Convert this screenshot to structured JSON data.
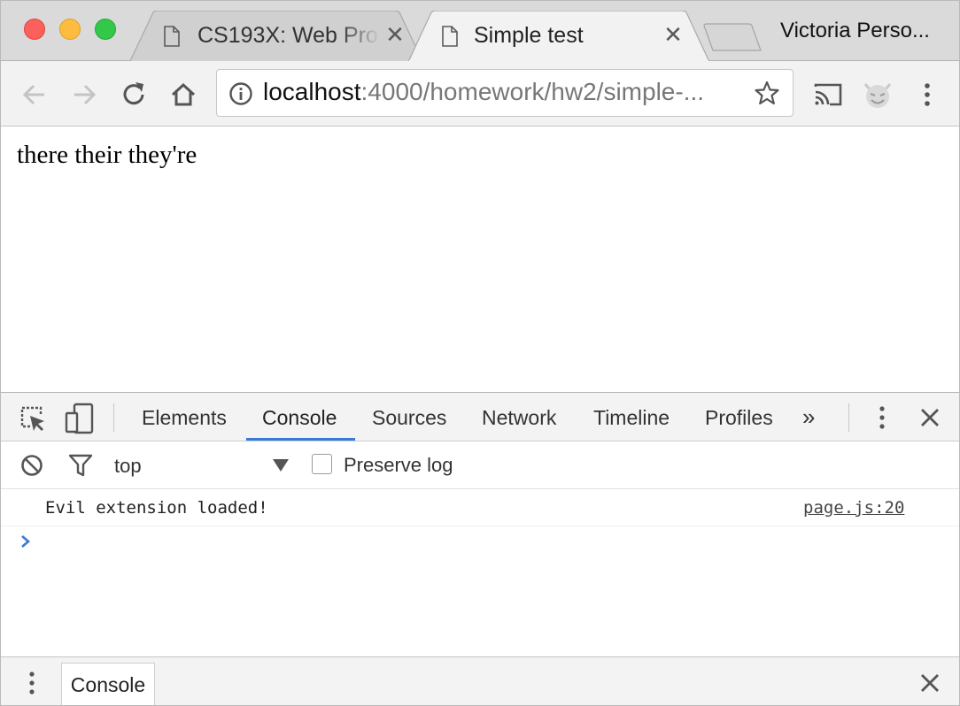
{
  "browser": {
    "tabs": [
      {
        "title": "CS193X: Web Pro",
        "active": false
      },
      {
        "title": "Simple test",
        "active": true
      }
    ],
    "profile_name": "Victoria Perso...",
    "url": {
      "host": "localhost",
      "path": ":4000/homework/hw2/simple-..."
    },
    "icons": {
      "back": "back-arrow-icon",
      "forward": "forward-arrow-icon",
      "reload": "reload-icon",
      "home": "home-icon",
      "info": "info-icon",
      "bookmark": "star-icon",
      "cast": "cast-icon",
      "extension": "devil-extension-icon",
      "menu": "kebab-menu-icon"
    }
  },
  "page": {
    "text": "there their they're"
  },
  "devtools": {
    "tabs": [
      "Elements",
      "Console",
      "Sources",
      "Network",
      "Timeline",
      "Profiles"
    ],
    "active_tab": "Console",
    "more_tabs_glyph": "»",
    "context": "top",
    "preserve_log_label": "Preserve log",
    "preserve_log_checked": false,
    "messages": [
      {
        "text": "Evil extension loaded!",
        "source": "page.js:20"
      }
    ],
    "drawer_tab": "Console",
    "accent_color": "#3879d9"
  }
}
